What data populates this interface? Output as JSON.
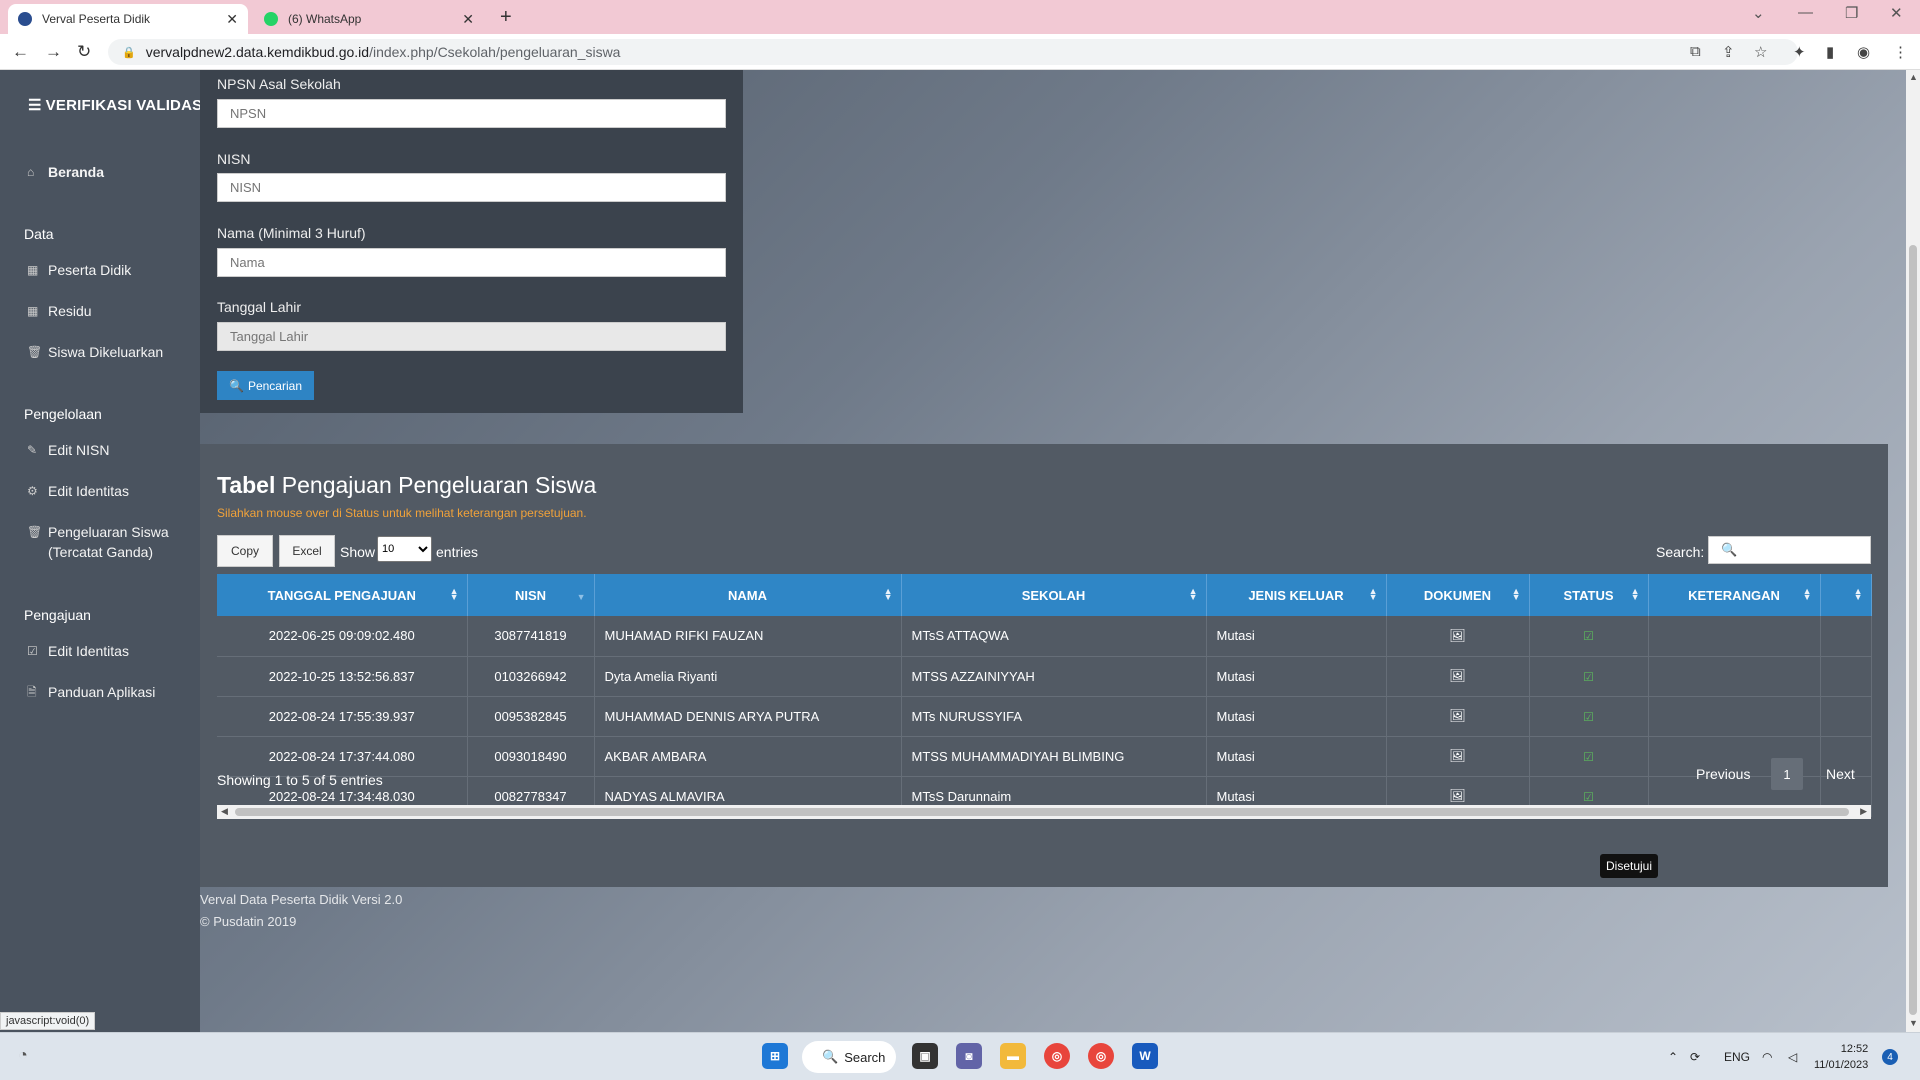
{
  "browser": {
    "tabs": [
      {
        "title": "Verval Peserta Didik",
        "active": true
      },
      {
        "title": "(6) WhatsApp",
        "active": false
      }
    ],
    "url_host": "vervalpdnew2.data.kemdikbud.go.id",
    "url_path": "/index.php/Csekolah/pengeluaran_siswa",
    "status_link": "javascript:void(0)"
  },
  "sidebar": {
    "brand": "VERIFIKASI VALIDASI",
    "home": "Beranda",
    "sections": [
      {
        "heading": "Data",
        "items": [
          "Peserta Didik",
          "Residu",
          "Siswa Dikeluarkan"
        ]
      },
      {
        "heading": "Pengelolaan",
        "items": [
          "Edit NISN",
          "Edit Identitas",
          "Pengeluaran Siswa (Tercatat Ganda)"
        ]
      },
      {
        "heading": "Pengajuan",
        "items": [
          "Edit Identitas",
          "Panduan Aplikasi"
        ]
      }
    ]
  },
  "form": {
    "npsn_label": "NPSN Asal Sekolah",
    "npsn_placeholder": "NPSN",
    "nisn_label": "NISN",
    "nisn_placeholder": "NISN",
    "nama_label": "Nama (Minimal 3 Huruf)",
    "nama_placeholder": "Nama",
    "tgl_label": "Tanggal Lahir",
    "tgl_placeholder": "Tanggal Lahir",
    "search_button": "Pencarian"
  },
  "table_panel": {
    "title_bold": "Tabel",
    "title_rest": "Pengajuan Pengeluaran Siswa",
    "note": "Silahkan mouse over di Status untuk melihat keterangan persetujuan.",
    "copy_button": "Copy",
    "excel_button": "Excel",
    "show_label": "Show",
    "show_value": "10",
    "entries_label": "entries",
    "search_label": "Search:",
    "columns": [
      "TANGGAL PENGAJUAN",
      "NISN",
      "NAMA",
      "SEKOLAH",
      "JENIS KELUAR",
      "DOKUMEN",
      "STATUS",
      "KETERANGAN",
      ""
    ],
    "rows": [
      {
        "tanggal": "2022-06-25 09:09:02.480",
        "nisn": "3087741819",
        "nama": "MUHAMAD RIFKI FAUZAN",
        "sekolah": "MTsS ATTAQWA",
        "jenis": "Mutasi"
      },
      {
        "tanggal": "2022-10-25 13:52:56.837",
        "nisn": "0103266942",
        "nama": "Dyta Amelia Riyanti",
        "sekolah": "MTSS AZZAINIYYAH",
        "jenis": "Mutasi"
      },
      {
        "tanggal": "2022-08-24 17:55:39.937",
        "nisn": "0095382845",
        "nama": "MUHAMMAD DENNIS ARYA PUTRA",
        "sekolah": "MTs NURUSSYIFA",
        "jenis": "Mutasi"
      },
      {
        "tanggal": "2022-08-24 17:37:44.080",
        "nisn": "0093018490",
        "nama": "AKBAR AMBARA",
        "sekolah": "MTSS MUHAMMADIYAH BLIMBING",
        "jenis": "Mutasi"
      },
      {
        "tanggal": "2022-08-24 17:34:48.030",
        "nisn": "0082778347",
        "nama": "NADYAS ALMAVIRA",
        "sekolah": "MTsS Darunnaim",
        "jenis": "Mutasi"
      }
    ],
    "tooltip": "Disetujui",
    "showing_info": "Showing 1 to 5 of 5 entries",
    "prev": "Previous",
    "page": "1",
    "next": "Next"
  },
  "footer": {
    "line1": "Verval Data Peserta Didik Versi 2.0",
    "line2": "© Pusdatin 2019"
  },
  "taskbar": {
    "search": "Search",
    "lang": "ENG",
    "time": "12:52",
    "date": "11/01/2023",
    "notifications": "4"
  },
  "colors": {
    "table_header": "#2f86c6",
    "status_ok": "#5cb85c",
    "note": "#f0a23a"
  }
}
